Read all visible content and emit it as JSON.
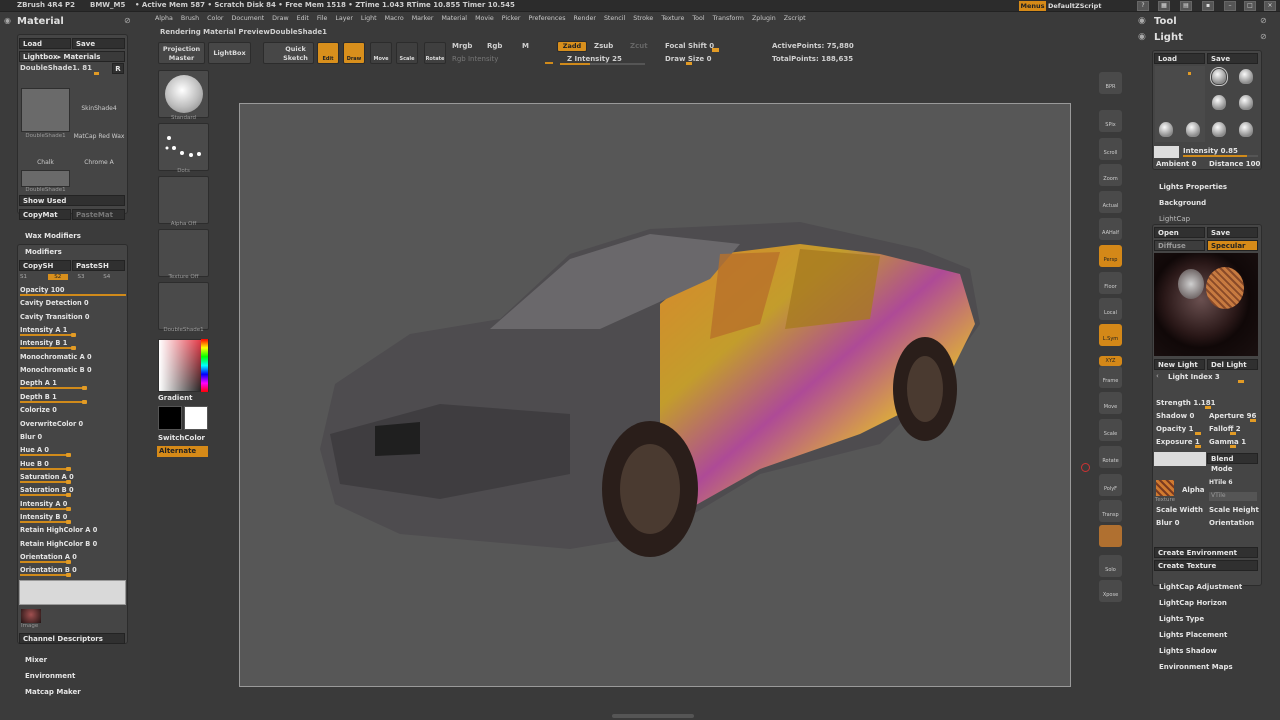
{
  "topbar": {
    "app": "ZBrush 4R4 P2",
    "doc": "BMW_M5",
    "stats": "• Active Mem 587 • Scratch Disk 84 • Free Mem 1518 • ZTime 1.043 RTime 10.855 Timer 10.545",
    "menus": "Menus",
    "script": "DefaultZScript"
  },
  "menubar": [
    "Alpha",
    "Brush",
    "Color",
    "Document",
    "Draw",
    "Edit",
    "File",
    "Layer",
    "Light",
    "Macro",
    "Marker",
    "Material",
    "Movie",
    "Picker",
    "Preferences",
    "Render",
    "Stencil",
    "Stroke",
    "Texture",
    "Tool",
    "Transform",
    "Zplugin",
    "Zscript"
  ],
  "material": {
    "title": "Material",
    "load": "Load",
    "save": "Save",
    "lightbox": "Lightbox▸ Materials",
    "current": "DoubleShade1. 81",
    "r": "R",
    "thumbs": [
      "DoubleShade1",
      "SkinShade4",
      "MatCap Red Wax",
      "Chalk",
      "Chrome A",
      "DoubleShade1"
    ],
    "show_used": "Show Used",
    "copymat": "CopyMat",
    "pastemat": "PasteMat",
    "wax": "Wax Modifiers",
    "modifiers": "Modifiers",
    "copysh": "CopySH",
    "pastesh": "PasteSH",
    "s_labels": [
      "S1",
      "S2",
      "S3",
      "S4"
    ],
    "sliders": [
      {
        "label": "Opacity 100",
        "value": 1.0
      },
      {
        "label": "Cavity Detection 0",
        "value": 0
      },
      {
        "label": "Cavity Transition 0",
        "value": 0
      },
      {
        "label": "Intensity A 1",
        "value": 0.5
      },
      {
        "label": "Intensity B 1",
        "value": 0.5
      },
      {
        "label": "Monochromatic A 0",
        "value": 0
      },
      {
        "label": "Monochromatic B 0",
        "value": 0
      },
      {
        "label": "Depth A 1",
        "value": 0.6
      },
      {
        "label": "Depth B 1",
        "value": 0.6
      },
      {
        "label": "Colorize 0",
        "value": 0
      },
      {
        "label": "OverwriteColor 0",
        "value": 0
      },
      {
        "label": "Blur 0",
        "value": 0
      },
      {
        "label": "Hue A 0",
        "value": 0.45
      },
      {
        "label": "Hue B 0",
        "value": 0.45
      },
      {
        "label": "Saturation A 0",
        "value": 0.45
      },
      {
        "label": "Saturation B 0",
        "value": 0.45
      },
      {
        "label": "Intensity A 0",
        "value": 0.45
      },
      {
        "label": "Intensity B 0",
        "value": 0.45
      },
      {
        "label": "Retain HighColor A 0",
        "value": 0
      },
      {
        "label": "Retain HighColor B 0",
        "value": 0
      },
      {
        "label": "Orientation A 0",
        "value": 0.45
      },
      {
        "label": "Orientation B 0",
        "value": 0.45
      }
    ],
    "image": "Image",
    "channel": "Channel Descriptors",
    "mixer": "Mixer",
    "environment": "Environment",
    "matcap_maker": "Matcap Maker"
  },
  "toolcol": {
    "brushes": [
      "Standard",
      "Dots",
      "Alpha Off",
      "Texture Off",
      "DoubleShade1"
    ],
    "gradient": "Gradient",
    "switchcolor": "SwitchColor",
    "alternate": "Alternate"
  },
  "toolbar": {
    "status": "Rendering Material PreviewDoubleShade1",
    "projection": "Projection Master",
    "lightbox": "LightBox",
    "quicksketch": "Quick Sketch",
    "edit": "Edit",
    "draw": "Draw",
    "move": "Move",
    "scale": "Scale",
    "rotate": "Rotate",
    "mrgb": "Mrgb",
    "rgb": "Rgb",
    "m": "M",
    "rgb_intensity": "Rgb Intensity",
    "zadd": "Zadd",
    "zsub": "Zsub",
    "zcut": "Zcut",
    "z_intensity": "Z Intensity 25",
    "focal": "Focal Shift 0",
    "draw_size": "Draw Size 0",
    "active_points": "ActivePoints: 75,880",
    "total_points": "TotalPoints: 188,635"
  },
  "shelf": [
    "BPR",
    "SPix",
    "Scroll",
    "Zoom",
    "Actual",
    "AAHalf",
    "Persp",
    "Floor",
    "Local",
    "L.Sym",
    "XYZ",
    "Frame",
    "Move",
    "Scale",
    "Rotate",
    "PolyF",
    "Transp",
    "",
    "Solo",
    "Xpose"
  ],
  "light": {
    "tool": "Tool",
    "title": "Light",
    "load": "Load",
    "save": "Save",
    "intensity": "Intensity 0.85",
    "ambient": "Ambient 0",
    "distance": "Distance 100",
    "lights_properties": "Lights Properties",
    "background": "Background",
    "lightcap": "LightCap",
    "open": "Open",
    "lc_save": "Save",
    "diffuse": "Diffuse",
    "specular": "Specular",
    "new_light": "New Light",
    "del_light": "Del Light",
    "light_index": "Light Index 3",
    "strength": "Strength 1.181",
    "shadow": "Shadow 0",
    "aperture": "Aperture 96",
    "opacity": "Opacity 1",
    "falloff": "Falloff 2",
    "exposure": "Exposure 1",
    "gamma": "Gamma 1",
    "blend_mode": "Blend Mode",
    "texture": "Texture",
    "alpha": "Alpha",
    "htile": "HTile 6",
    "vtile": "VTile",
    "scale_width": "Scale Width",
    "scale_height": "Scale Height",
    "blur": "Blur 0",
    "orientation": "Orientation",
    "create_env": "Create Environment",
    "create_tex": "Create Texture",
    "sections": [
      "LightCap Adjustment",
      "LightCap Horizon",
      "Lights Type",
      "Lights Placement",
      "Lights Shadow",
      "Environment Maps"
    ]
  }
}
